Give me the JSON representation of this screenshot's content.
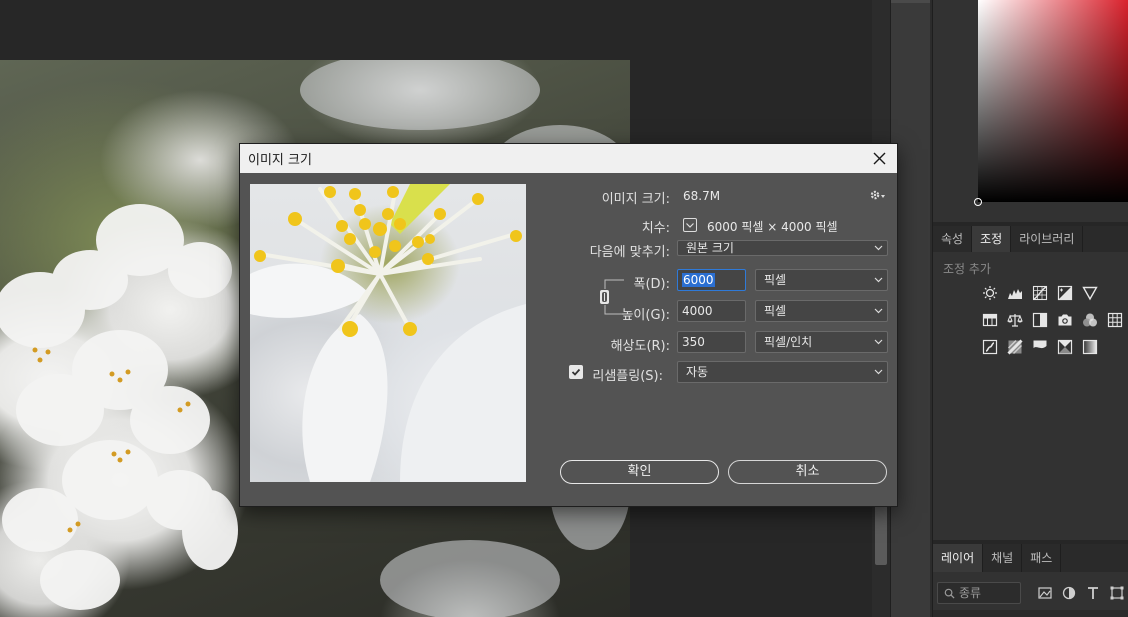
{
  "dialog": {
    "title": "이미지 크기",
    "image_size_label": "이미지 크기:",
    "image_size_value": "68.7M",
    "dimensions_label": "치수:",
    "dimensions_value": "6000 픽셀 × 4000 픽셀",
    "fit_to_label": "다음에 맞추기:",
    "fit_to_value": "원본 크기",
    "width_label": "폭(D):",
    "width_value": "6000",
    "width_unit": "픽셀",
    "height_label": "높이(G):",
    "height_value": "4000",
    "height_unit": "픽셀",
    "resolution_label": "해상도(R):",
    "resolution_value": "350",
    "resolution_unit": "픽셀/인치",
    "resample_label": "리샘플링(S):",
    "resample_checked": true,
    "resample_value": "자동",
    "ok_label": "확인",
    "cancel_label": "취소"
  },
  "panels": {
    "top_tabs": [
      "속성",
      "조정",
      "라이브러리"
    ],
    "active_top_tab": "조정",
    "adjustments_title": "조정 추가",
    "bottom_tabs": [
      "레이어",
      "채널",
      "패스"
    ],
    "active_bottom_tab": "레이어",
    "layer_filter_label": "종류"
  },
  "colors": {
    "accent": "#2b6fd1",
    "dialog_bg": "#535353",
    "panel_bg": "#323232",
    "hue": "#d9202b"
  }
}
